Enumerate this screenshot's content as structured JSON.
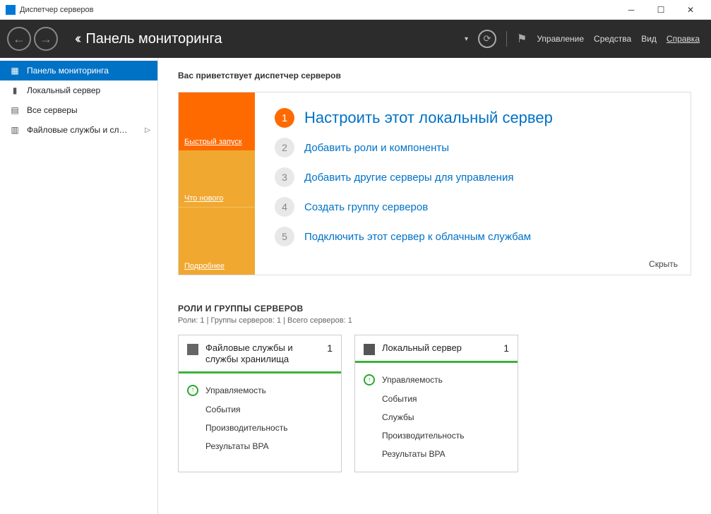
{
  "window": {
    "title": "Диспетчер серверов"
  },
  "header": {
    "title": "Панель мониторинга",
    "menu": {
      "manage": "Управление",
      "tools": "Средства",
      "view": "Вид",
      "help": "Справка"
    }
  },
  "sidebar": {
    "dashboard": "Панель мониторинга",
    "local": "Локальный сервер",
    "all": "Все серверы",
    "file": "Файловые службы и сл…"
  },
  "main": {
    "welcome": "Вас приветствует диспетчер серверов",
    "tabs": {
      "quick": "Быстрый запуск",
      "whatsnew": "Что нового",
      "more": "Подробнее"
    },
    "steps": {
      "s1": "Настроить этот локальный сервер",
      "s2": "Добавить роли и компоненты",
      "s3": "Добавить другие серверы для управления",
      "s4": "Создать группу серверов",
      "s5": "Подключить этот сервер к облачным службам",
      "n1": "1",
      "n2": "2",
      "n3": "3",
      "n4": "4",
      "n5": "5"
    },
    "hide": "Скрыть",
    "roles": {
      "title": "РОЛИ И ГРУППЫ СЕРВЕРОВ",
      "subtitle": "Роли: 1 | Группы серверов: 1 | Всего серверов: 1",
      "tile1": {
        "title": "Файловые службы и службы хранилища",
        "count": "1",
        "rows": {
          "r1": "Управляемость",
          "r2": "События",
          "r3": "Производительность",
          "r4": "Результаты BPA"
        }
      },
      "tile2": {
        "title": "Локальный сервер",
        "count": "1",
        "rows": {
          "r1": "Управляемость",
          "r2": "События",
          "r3": "Службы",
          "r4": "Производительность",
          "r5": "Результаты BPA"
        }
      }
    }
  }
}
